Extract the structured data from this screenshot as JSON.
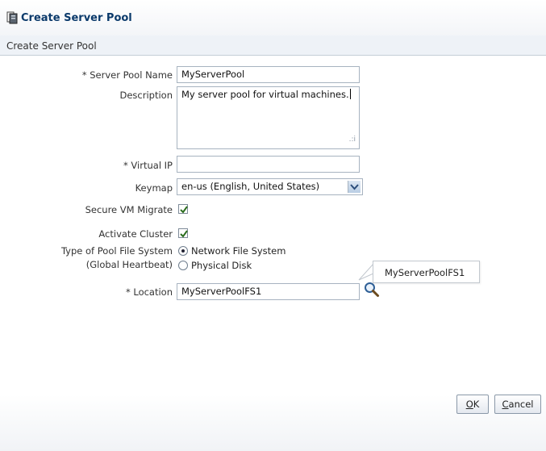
{
  "window": {
    "title": "Create Server Pool"
  },
  "subheader": {
    "title": "Create Server Pool"
  },
  "form": {
    "server_pool_name": {
      "label": "* Server Pool Name",
      "value": "MyServerPool"
    },
    "description": {
      "label": "Description",
      "value": "My server pool for virtual machines."
    },
    "virtual_ip": {
      "label": "* Virtual IP",
      "value": ""
    },
    "keymap": {
      "label": "Keymap",
      "selected": "en-us (English, United States)"
    },
    "secure_vm_migrate": {
      "label": "Secure VM Migrate",
      "checked": true
    },
    "activate_cluster": {
      "label": "Activate Cluster",
      "checked": true
    },
    "pool_fs_type": {
      "label_line1": "Type of Pool File System",
      "label_line2": "(Global Heartbeat)",
      "options": [
        "Network File System",
        "Physical Disk"
      ],
      "selected": "Network File System"
    },
    "location": {
      "label": "* Location",
      "value": "MyServerPoolFS1",
      "tooltip": "MyServerPoolFS1"
    }
  },
  "buttons": {
    "ok": {
      "mnemonic": "O",
      "rest": "K"
    },
    "cancel": {
      "mnemonic": "C",
      "rest": "ancel"
    }
  },
  "colors": {
    "title": "#0b3a6b",
    "border": "#a7b3c0",
    "header_bg": "#eef2f7"
  }
}
